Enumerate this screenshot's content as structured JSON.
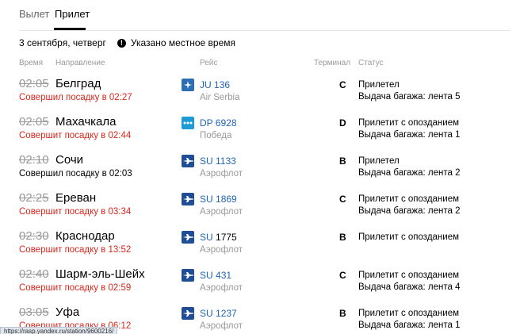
{
  "tabs": [
    {
      "label": "Вылет",
      "active": false
    },
    {
      "label": "Прилет",
      "active": true
    }
  ],
  "date": "3 сентября, четверг",
  "local_time_note": "Указано местное время",
  "headers": {
    "time": "Время",
    "direction": "Направление",
    "flight": "Рейс",
    "terminal": "Терминал",
    "status": "Статус"
  },
  "flights": [
    {
      "time": "02:05",
      "city": "Белград",
      "boarding": "Совершил посадку в 02:27",
      "boarding_color": "red",
      "logo": "air-serbia-logo",
      "logo_color": "#2a6fb5",
      "code": "JU",
      "number": "136",
      "airline": "Air Serbia",
      "terminal": "C",
      "status1": "Прилетел",
      "status2": "Выдача багажа: лента 5"
    },
    {
      "time": "02:05",
      "city": "Махачкала",
      "boarding": "Совершит посадку в 02:44",
      "boarding_color": "red",
      "logo": "pobeda-logo",
      "logo_color": "#1e9bd7",
      "code": "DP",
      "number": "6928",
      "airline": "Победа",
      "terminal": "D",
      "status1": "Прилетит с опозданием",
      "status2": "Выдача багажа: лента 1"
    },
    {
      "time": "02:10",
      "city": "Сочи",
      "boarding": "Совершил посадку в 02:03",
      "boarding_color": "black",
      "logo": "aeroflot-logo",
      "logo_color": "#1f4e96",
      "code": "SU",
      "number": "1133",
      "airline": "Аэрофлот",
      "terminal": "B",
      "status1": "Прилетел",
      "status2": "Выдача багажа: лента 2"
    },
    {
      "time": "02:25",
      "city": "Ереван",
      "boarding": "Совершит посадку в 03:34",
      "boarding_color": "red",
      "logo": "aeroflot-logo",
      "logo_color": "#1f4e96",
      "code": "SU",
      "number": "1869",
      "airline": "Аэрофлот",
      "terminal": "C",
      "status1": "Прилетит с опозданием",
      "status2": "Выдача багажа: лента 2"
    },
    {
      "time": "02:30",
      "city": "Краснодар",
      "boarding": "Совершит посадку в 13:52",
      "boarding_color": "red",
      "logo": "aeroflot-logo",
      "logo_color": "#1f4e96",
      "code": "SU",
      "number": "1775",
      "airline": "Аэрофлот",
      "terminal": "B",
      "status1": "Прилетит с опозданием",
      "status2": ""
    },
    {
      "time": "02:40",
      "city": "Шарм-эль-Шейх",
      "boarding": "Совершит посадку в 02:59",
      "boarding_color": "red",
      "logo": "aeroflot-logo",
      "logo_color": "#1f4e96",
      "code": "SU",
      "number": "431",
      "airline": "Аэрофлот",
      "terminal": "C",
      "status1": "Прилетит с опозданием",
      "status2": "Выдача багажа: лента 4"
    },
    {
      "time": "03:05",
      "city": "Уфа",
      "boarding": "Совершит посадку в 06:12",
      "boarding_color": "red",
      "logo": "aeroflot-logo",
      "logo_color": "#1f4e96",
      "code": "SU",
      "number": "1237",
      "airline": "Аэрофлот",
      "terminal": "B",
      "status1": "Прилетит с опозданием",
      "status2": "Выдача багажа: лента 1"
    }
  ],
  "status_bar_url": "https://rasp.yandex.ru/station/9600216/"
}
